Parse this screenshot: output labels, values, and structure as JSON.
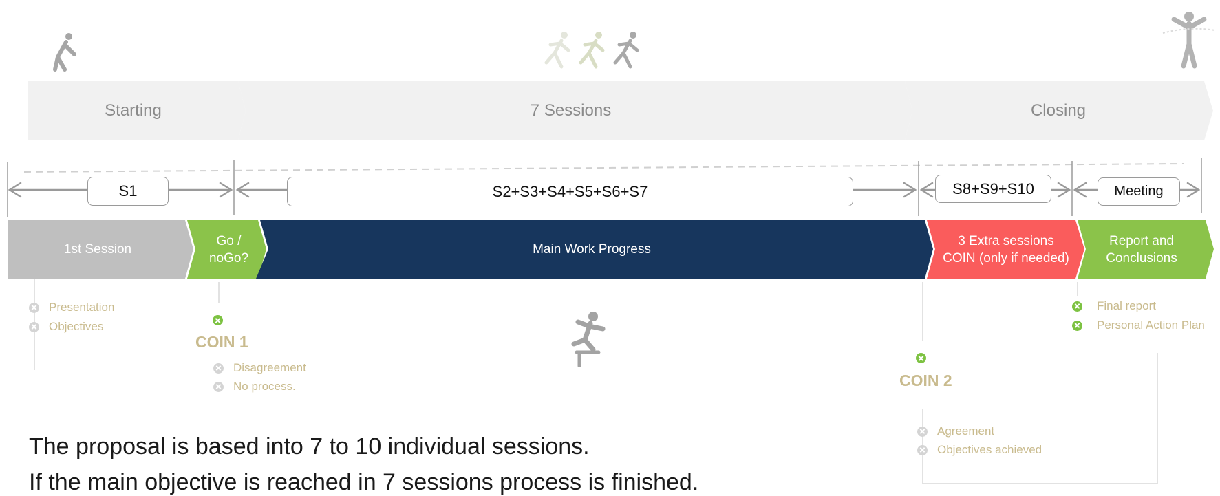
{
  "phases": [
    {
      "label": "Starting"
    },
    {
      "label": "7 Sessions"
    },
    {
      "label": "Closing"
    }
  ],
  "sessions": [
    {
      "label": "S1"
    },
    {
      "label": "S2+S3+S4+S5+S6+S7"
    },
    {
      "label": "S8+S9+S10"
    },
    {
      "label": "Meeting"
    }
  ],
  "stages": [
    {
      "label": "1st Session",
      "color": "#bfbfbf"
    },
    {
      "label": "Go /\nnoGo?",
      "color": "#8bc34a"
    },
    {
      "label": "Main Work Progress",
      "color": "#17365d"
    },
    {
      "label": "3 Extra sessions\nCOIN (only if needed)",
      "color": "#fa5c5c"
    },
    {
      "label": "Report and\nConclusions",
      "color": "#8bc34a"
    }
  ],
  "first_session_items": [
    "Presentation",
    "Objectives"
  ],
  "coin1": {
    "title": "COIN 1",
    "items": [
      "Disagreement",
      "No process."
    ]
  },
  "coin2": {
    "title": "COIN 2",
    "items": [
      "Agreement",
      "Objectives achieved"
    ]
  },
  "report_items": [
    "Final report",
    "Personal Action Plan"
  ],
  "text": {
    "line1_pre": "The proposal is based into ",
    "line1_bold": "7 to 10 individual sessions",
    "line1_post": ".",
    "line2": "If the main objective is reached in 7 sessions process is finished."
  },
  "icons": [
    "stretching-person-icon",
    "runners-icon",
    "finish-line-runner-icon",
    "hurdle-jumper-icon"
  ]
}
